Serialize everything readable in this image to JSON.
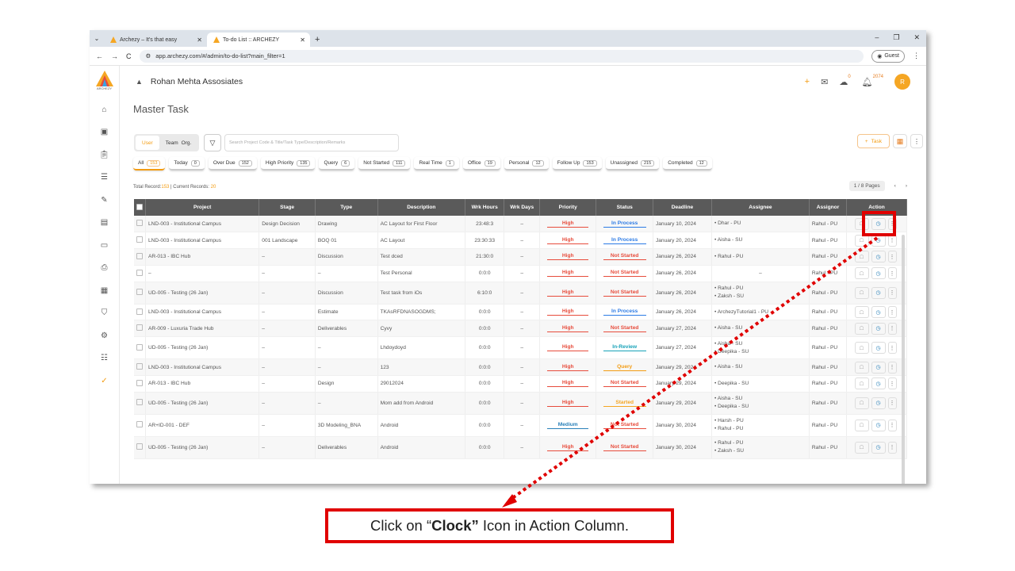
{
  "browser": {
    "tabs": [
      {
        "label": "Archezy – It's that easy"
      },
      {
        "label": "To-do List :: ARCHEZY"
      }
    ],
    "url": "app.archezy.com/#/admin/to-do-list?main_filter=1",
    "guest_label": "Guest"
  },
  "header": {
    "company": "Rohan Mehta Assosiates",
    "chat_count": "0",
    "bell_count": "2074",
    "avatar": "R",
    "brand_small": "ARCHEZY"
  },
  "page": {
    "title": "Master Task"
  },
  "toggle": {
    "user": "User",
    "team": "Team",
    "org": "Org."
  },
  "search": {
    "placeholder": "Search Project Code & Title/Task Type/Description/Remarks"
  },
  "task_button": "Task",
  "chips": [
    {
      "label": "All",
      "count": "153"
    },
    {
      "label": "Today",
      "count": "0"
    },
    {
      "label": "Over Due",
      "count": "152"
    },
    {
      "label": "High Priority",
      "count": "135"
    },
    {
      "label": "Query",
      "count": "6"
    },
    {
      "label": "Not Started",
      "count": "111"
    },
    {
      "label": "Real Time",
      "count": "1"
    },
    {
      "label": "Office",
      "count": "19"
    },
    {
      "label": "Personal",
      "count": "12"
    },
    {
      "label": "Follow Up",
      "count": "153"
    },
    {
      "label": "Unassigned",
      "count": "215"
    },
    {
      "label": "Completed",
      "count": "12"
    }
  ],
  "records": {
    "label": "Total Record:",
    "total": "153",
    "sep": " | Current Records: ",
    "current": "20"
  },
  "pager": {
    "label": "1 / 8 Pages",
    "prev": "‹",
    "next": "›"
  },
  "table": {
    "headers": [
      "Project",
      "Stage",
      "Type",
      "Description",
      "Wrk Hours",
      "Wrk Days",
      "Priority",
      "Status",
      "Deadline",
      "Assignee",
      "Assignor",
      "Action"
    ],
    "rows": [
      {
        "project": "LND-003 - Institutional Campus",
        "stage": "Design Decision",
        "type": "Drawing",
        "desc": "AC Layout for First Floor",
        "hours": "23:48:3",
        "days": "–",
        "priority": "High",
        "status": "In Process",
        "deadline": "January 10, 2024",
        "assignee": [
          "Dhar - PU"
        ],
        "assignor": "Rahul - PU"
      },
      {
        "project": "LND-003 - Institutional Campus",
        "stage": "001 Landscape",
        "type": "BOQ 01",
        "desc": "AC Layout",
        "hours": "23:30:33",
        "days": "–",
        "priority": "High",
        "status": "In Process",
        "deadline": "January 20, 2024",
        "assignee": [
          "Aisha - SU"
        ],
        "assignor": "Rahul - PU"
      },
      {
        "project": "AR-013 - IBC Hub",
        "stage": "–",
        "type": "Discussion",
        "desc": "Test dced",
        "hours": "21:30:0",
        "days": "–",
        "priority": "High",
        "status": "Not Started",
        "deadline": "January 26, 2024",
        "assignee": [
          "Rahul - PU"
        ],
        "assignor": "Rahul - PU"
      },
      {
        "project": "–",
        "stage": "–",
        "type": "–",
        "desc": "Test Personal",
        "hours": "0:0:0",
        "days": "–",
        "priority": "High",
        "status": "Not Started",
        "deadline": "January 26, 2024",
        "assignee": [],
        "assignee_empty": "–",
        "assignor": "Rahul - PU"
      },
      {
        "project": "UD-005 - Testing (26 Jan)",
        "stage": "–",
        "type": "Discussion",
        "desc": "Test task from iOs",
        "hours": "6:10:0",
        "days": "–",
        "priority": "High",
        "status": "Not Started",
        "deadline": "January 26, 2024",
        "assignee": [
          "Rahul - PU",
          "Zaksh - SU"
        ],
        "assignor": "Rahul - PU"
      },
      {
        "project": "LND-003 - Institutional Campus",
        "stage": "–",
        "type": "Estimate",
        "desc": "TKAsRFDNASOGDMS;",
        "hours": "0:0:0",
        "days": "–",
        "priority": "High",
        "status": "In Process",
        "deadline": "January 26, 2024",
        "assignee": [
          "ArchezyTutorial1 - PU"
        ],
        "assignor": "Rahul - PU"
      },
      {
        "project": "AR-009 - Luxuria Trade Hub",
        "stage": "–",
        "type": "Deliverables",
        "desc": "Cyvy",
        "hours": "0:0:0",
        "days": "–",
        "priority": "High",
        "status": "Not Started",
        "deadline": "January 27, 2024",
        "assignee": [
          "Aisha - SU"
        ],
        "assignor": "Rahul - PU"
      },
      {
        "project": "UD-005 - Testing (26 Jan)",
        "stage": "–",
        "type": "–",
        "desc": "Lhdoydoyd",
        "hours": "0:0:0",
        "days": "–",
        "priority": "High",
        "status": "In-Review",
        "deadline": "January 27, 2024",
        "assignee": [
          "Aisha - SU",
          "Deepika - SU"
        ],
        "assignor": "Rahul - PU"
      },
      {
        "project": "LND-003 - Institutional Campus",
        "stage": "–",
        "type": "–",
        "desc": "123",
        "hours": "0:0:0",
        "days": "–",
        "priority": "High",
        "status": "Query",
        "deadline": "January 29, 2024",
        "assignee": [
          "Aisha - SU"
        ],
        "assignor": "Rahul - PU"
      },
      {
        "project": "AR-013 - IBC Hub",
        "stage": "–",
        "type": "Design",
        "desc": "29012024",
        "hours": "0:0:0",
        "days": "–",
        "priority": "High",
        "status": "Not Started",
        "deadline": "January 29, 2024",
        "assignee": [
          "Deepika - SU"
        ],
        "assignor": "Rahul - PU"
      },
      {
        "project": "UD-005 - Testing (26 Jan)",
        "stage": "–",
        "type": "–",
        "desc": "Mom add from Android",
        "hours": "0:0:0",
        "days": "–",
        "priority": "High",
        "status": "Started",
        "deadline": "January 29, 2024",
        "assignee": [
          "Aisha - SU",
          "Deepika - SU"
        ],
        "assignor": "Rahul - PU"
      },
      {
        "project": "AR+ID-001 - DEF",
        "stage": "–",
        "type": "3D Modeling_BNA",
        "desc": "Android",
        "hours": "0:0:0",
        "days": "–",
        "priority": "Medium",
        "status": "Not Started",
        "deadline": "January 30, 2024",
        "assignee": [
          "Harsh - PU",
          "Rahul - PU"
        ],
        "assignor": "Rahul - PU"
      },
      {
        "project": "UD-005 - Testing (26 Jan)",
        "stage": "–",
        "type": "Deliverables",
        "desc": "Android",
        "hours": "0:0:0",
        "days": "–",
        "priority": "High",
        "status": "Not Started",
        "deadline": "January 30, 2024",
        "assignee": [
          "Rahul - PU",
          "Zaksh - SU"
        ],
        "assignor": "Rahul - PU"
      }
    ]
  },
  "status_colors": {
    "In Process": "#2c7be5",
    "Not Started": "#e74c3c",
    "In-Review": "#17a2b8",
    "Query": "#f39c12",
    "Started": "#f5a623"
  },
  "callout": {
    "before": "Click on “",
    "bold": "Clock”",
    "after": " Icon in Action Column."
  }
}
